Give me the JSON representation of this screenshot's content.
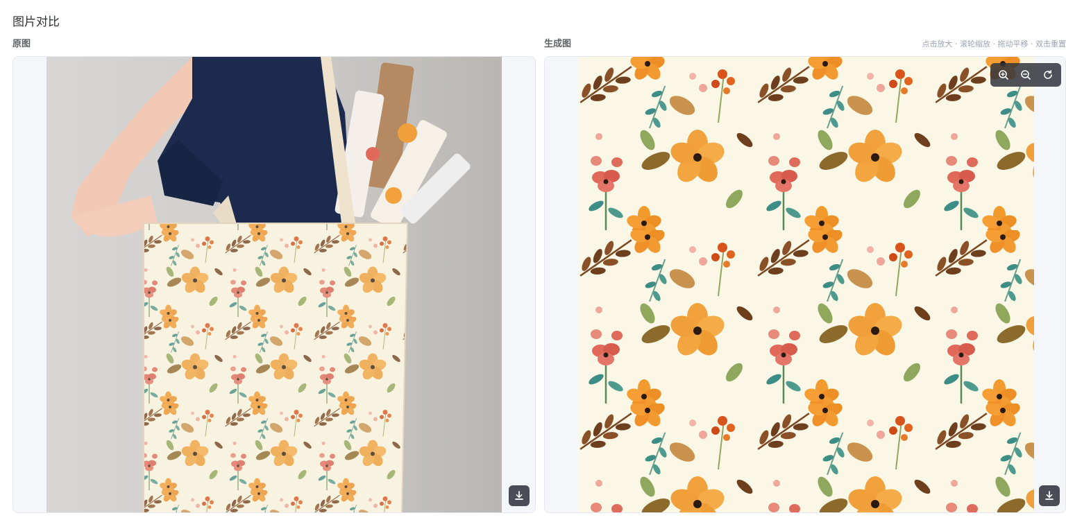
{
  "page": {
    "title": "图片对比"
  },
  "original": {
    "label": "原图",
    "download_icon": "download-icon"
  },
  "generated": {
    "label": "生成图",
    "hint": "点击放大 · 滚轮缩放 · 拖动平移 · 双击重置",
    "toolbar": {
      "zoom_in_icon": "zoom-in-icon",
      "zoom_out_icon": "zoom-out-icon",
      "reset_icon": "reset-icon"
    },
    "download_icon": "download-icon"
  },
  "colors": {
    "pattern_bg": "#fbf7e6",
    "bag_bg": "#efe3cf",
    "wall": "#cdcbc9",
    "shirt": "#1c2b4d",
    "orange_flower": "#f2a23c",
    "red_flower": "#e0695a",
    "brown_leaf": "#7a4a24",
    "green_leaf": "#8fa85e",
    "teal_leaf": "#3e8c86"
  }
}
